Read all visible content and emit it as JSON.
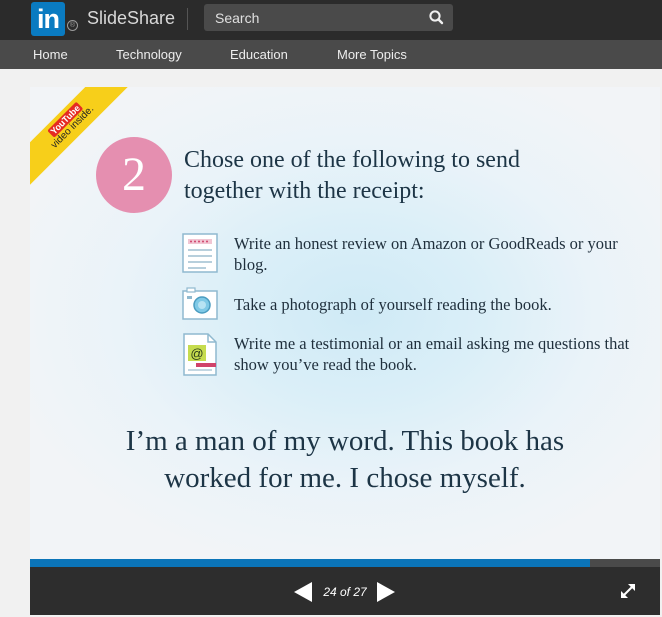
{
  "header": {
    "logo_mark": "in",
    "brand": "SlideShare",
    "search_placeholder": "Search",
    "search_icon": "search-icon"
  },
  "nav": {
    "items": [
      {
        "label": "Home"
      },
      {
        "label": "Technology"
      },
      {
        "label": "Education"
      },
      {
        "label": "More Topics"
      }
    ]
  },
  "slide": {
    "ribbon_brand": "YouTube",
    "ribbon_text": "video inside.",
    "step_number": "2",
    "step_title": "Chose one of the following to send together with the receipt:",
    "options": [
      {
        "icon": "review-list-icon",
        "text": "Write an honest review on Amazon or GoodReads or your blog."
      },
      {
        "icon": "camera-icon",
        "text": "Take a photograph of yourself reading the book."
      },
      {
        "icon": "email-document-icon",
        "text": "Write me a testimonial or an email asking me questions that show you’ve read the book."
      }
    ],
    "quote": "I’m a man of my word. This book has worked for me. I chose myself."
  },
  "player": {
    "page_counter": "24 of 27",
    "current_page": 24,
    "total_pages": 27,
    "progress_fraction": 0.889
  },
  "colors": {
    "accent_blue": "#0b74b8",
    "linkedin_blue": "#0a7bc1",
    "step_pink": "#e58fb0",
    "ribbon_yellow": "#f7cf1a"
  }
}
